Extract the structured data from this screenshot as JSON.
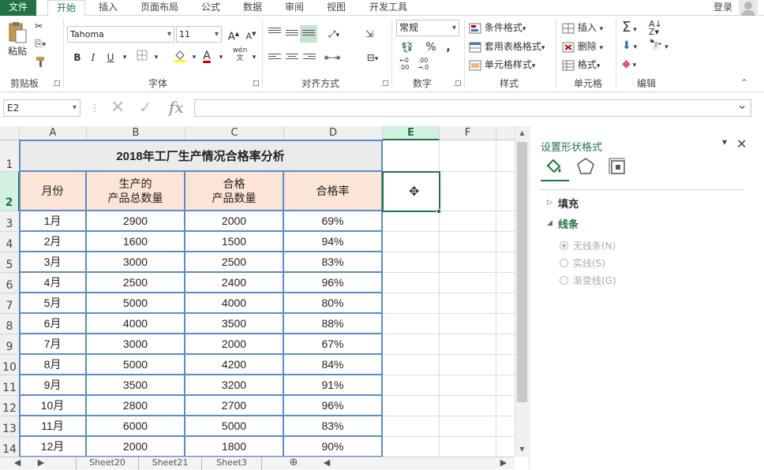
{
  "ribbon_tabs": [
    "文件",
    "开始",
    "插入",
    "页面布局",
    "公式",
    "数据",
    "审阅",
    "视图",
    "开发工具"
  ],
  "account": {
    "login_label": "登录"
  },
  "clipboard": {
    "paste_label": "粘贴",
    "group_label": "剪贴板"
  },
  "font": {
    "name": "Tahoma",
    "size": "11",
    "group_label": "字体",
    "bold": "B",
    "italic": "I",
    "underline": "U",
    "font_color_label": "A",
    "wen_label": "wén"
  },
  "alignment": {
    "group_label": "对齐方式"
  },
  "number": {
    "format": "常规",
    "percent": "%",
    "comma": ",",
    "group_label": "数字"
  },
  "styles": {
    "conditional": "条件格式",
    "table_format": "套用表格格式",
    "cell_styles": "单元格样式",
    "group_label": "样式"
  },
  "cells": {
    "insert": "插入",
    "delete": "删除",
    "format": "格式",
    "group_label": "单元格"
  },
  "editing": {
    "group_label": "编辑"
  },
  "formula_bar": {
    "name_box": "E2",
    "formula": ""
  },
  "grid": {
    "columns": [
      "A",
      "B",
      "C",
      "D",
      "E",
      "F"
    ],
    "row_numbers": [
      "1",
      "2",
      "3",
      "4",
      "5",
      "6",
      "7",
      "8",
      "9",
      "10",
      "11",
      "12",
      "13",
      "14"
    ],
    "title": "2018年工厂生产情况合格率分析",
    "headers": {
      "month": "月份",
      "produced_1": "生产的",
      "produced_2": "产品总数量",
      "qualified_1": "合格",
      "qualified_2": "产品数量",
      "rate": "合格率"
    },
    "rows": [
      [
        "1月",
        "2900",
        "2000",
        "69%"
      ],
      [
        "2月",
        "1600",
        "1500",
        "94%"
      ],
      [
        "3月",
        "3000",
        "2500",
        "83%"
      ],
      [
        "4月",
        "2500",
        "2400",
        "96%"
      ],
      [
        "5月",
        "5000",
        "4000",
        "80%"
      ],
      [
        "6月",
        "4000",
        "3500",
        "88%"
      ],
      [
        "7月",
        "3000",
        "2000",
        "67%"
      ],
      [
        "8月",
        "5000",
        "4200",
        "84%"
      ],
      [
        "9月",
        "3500",
        "3200",
        "91%"
      ],
      [
        "10月",
        "2800",
        "2700",
        "96%"
      ],
      [
        "11月",
        "6000",
        "5000",
        "83%"
      ],
      [
        "12月",
        "2000",
        "1800",
        "90%"
      ]
    ]
  },
  "sheet_tabs": [
    "Sheet20",
    "Sheet21",
    "Sheet3"
  ],
  "format_pane": {
    "title": "设置形状格式",
    "fill_label": "填充",
    "line_label": "线条",
    "line_options": [
      "无线条(N)",
      "实线(S)",
      "渐变线(G)"
    ],
    "selected_option": "无线条(N)"
  },
  "colors": {
    "accent": "#217346",
    "table_border": "#5b8cc6",
    "header_fill": "#fce4d6",
    "title_fill": "#ebebeb"
  }
}
